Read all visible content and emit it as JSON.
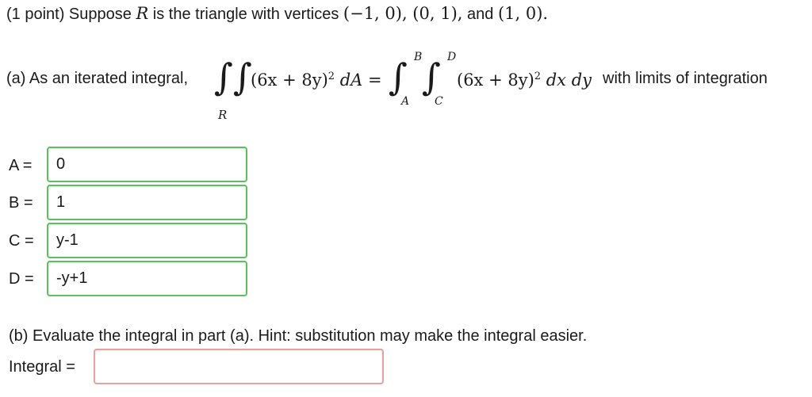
{
  "intro": {
    "prefix": "(1 point) Suppose ",
    "R": "R",
    "mid": " is the triangle with vertices ",
    "v1": "(−1, 0), (0, 1),",
    "and": " and ",
    "v2": "(1, 0)."
  },
  "part_a": {
    "lead": "(a) As an iterated integral,",
    "integrand": "(6x + 8y)",
    "exp": "2",
    "dA": "dA",
    "equals": "=",
    "integrand2": "(6x + 8y)",
    "exp2": "2",
    "dxdy": "dx dy",
    "tail": "with limits of integration",
    "region": "R",
    "upper_outer": "B",
    "lower_outer": "A",
    "upper_inner": "D",
    "lower_inner": "C"
  },
  "fields": [
    {
      "label": "A =",
      "value": "0"
    },
    {
      "label": "B =",
      "value": "1"
    },
    {
      "label": "C =",
      "value": "y-1"
    },
    {
      "label": "D =",
      "value": "-y+1"
    }
  ],
  "part_b": {
    "text": "(b) Evaluate the integral in part (a). Hint: substitution may make the integral easier.",
    "label": "Integral =",
    "value": ""
  },
  "colors": {
    "valid_border": "#5fbf60",
    "empty_border": "#e8a0a0"
  }
}
